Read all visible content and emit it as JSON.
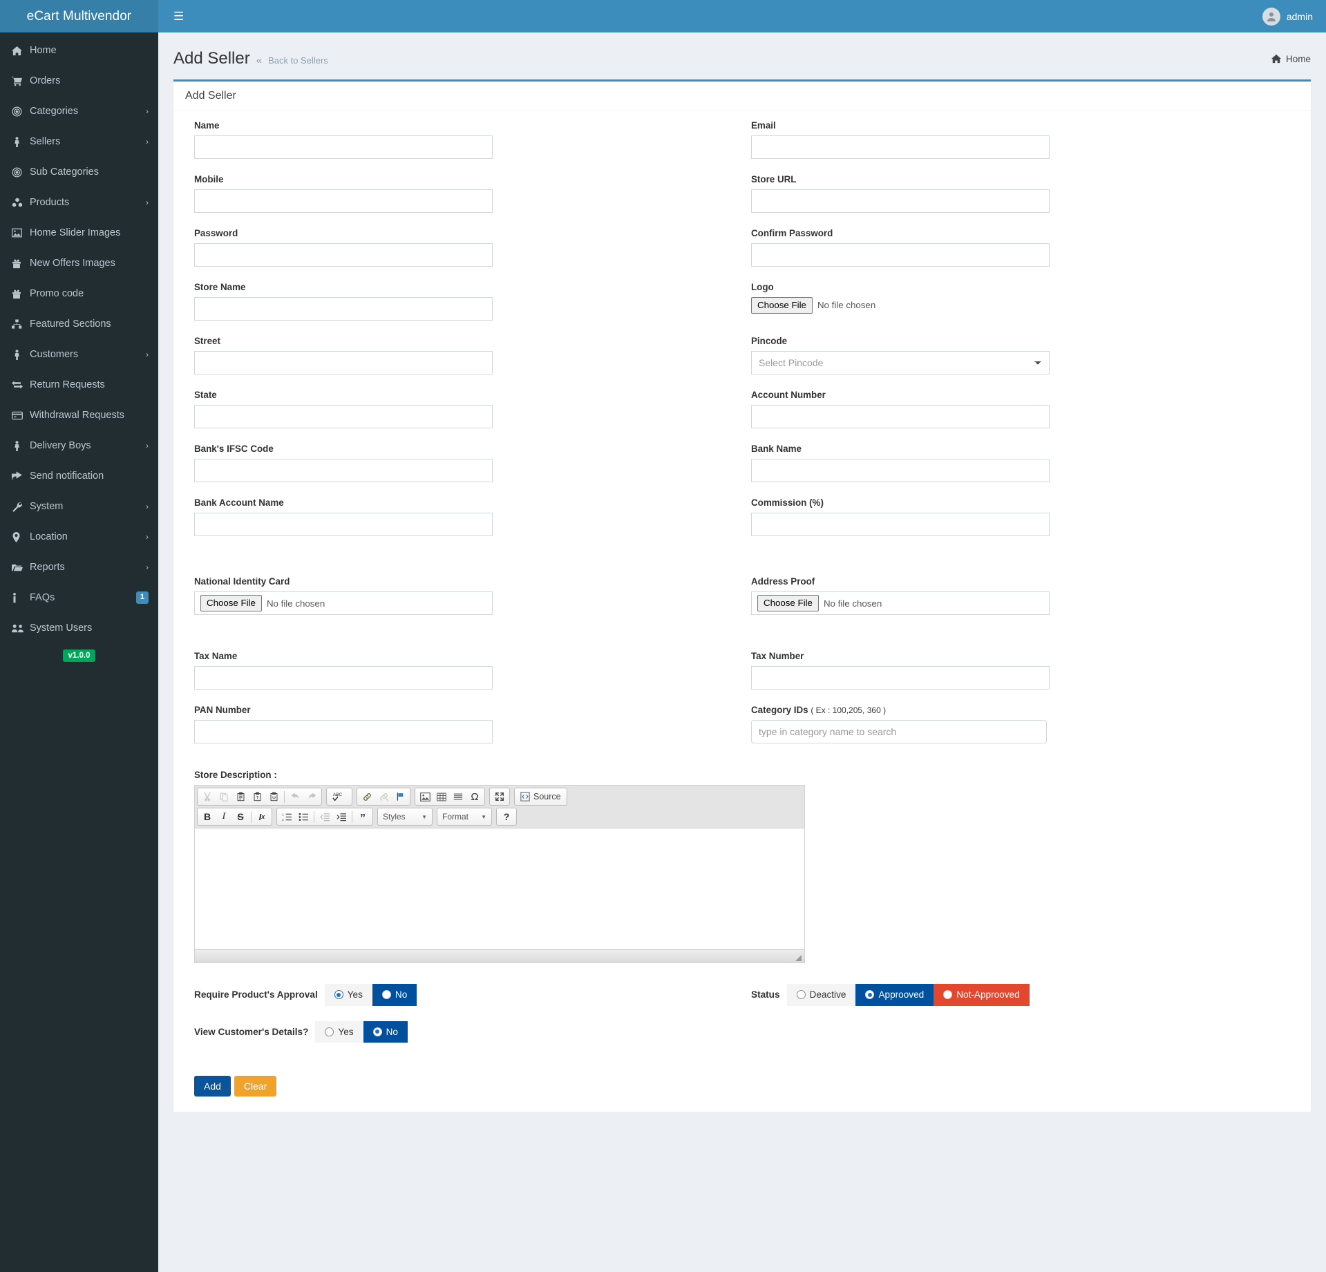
{
  "brand": {
    "title": "eCart Multivendor",
    "version": "v1.0.0"
  },
  "topbar": {
    "menu_toggle_icon": "hamburger-icon",
    "user_name": "admin"
  },
  "sidebar": {
    "items": [
      {
        "label": "Home",
        "icon": "home-icon",
        "arrow": ""
      },
      {
        "label": "Orders",
        "icon": "cart-icon",
        "arrow": ""
      },
      {
        "label": "Categories",
        "icon": "target-icon",
        "arrow": "›"
      },
      {
        "label": "Sellers",
        "icon": "person-icon",
        "arrow": "›"
      },
      {
        "label": "Sub Categories",
        "icon": "target-icon",
        "arrow": ""
      },
      {
        "label": "Products",
        "icon": "cubes-icon",
        "arrow": "›"
      },
      {
        "label": "Home Slider Images",
        "icon": "image-icon",
        "arrow": ""
      },
      {
        "label": "New Offers Images",
        "icon": "gift-icon",
        "arrow": ""
      },
      {
        "label": "Promo code",
        "icon": "gift-icon",
        "arrow": ""
      },
      {
        "label": "Featured Sections",
        "icon": "sitemap-icon",
        "arrow": ""
      },
      {
        "label": "Customers",
        "icon": "person-icon",
        "arrow": "›"
      },
      {
        "label": "Return Requests",
        "icon": "exchange-icon",
        "arrow": ""
      },
      {
        "label": "Withdrawal Requests",
        "icon": "credit-card-icon",
        "arrow": ""
      },
      {
        "label": "Delivery Boys",
        "icon": "person-icon",
        "arrow": "›"
      },
      {
        "label": "Send notification",
        "icon": "share-icon",
        "arrow": ""
      },
      {
        "label": "System",
        "icon": "wrench-icon",
        "arrow": "›"
      },
      {
        "label": "Location",
        "icon": "map-pin-icon",
        "arrow": "›"
      },
      {
        "label": "Reports",
        "icon": "folder-open-icon",
        "arrow": "›"
      },
      {
        "label": "FAQs",
        "icon": "info-icon",
        "arrow": "",
        "badge": "1"
      },
      {
        "label": "System Users",
        "icon": "users-icon",
        "arrow": ""
      }
    ]
  },
  "page": {
    "title": "Add Seller",
    "back_chevron": "«",
    "back_link": "Back to Sellers",
    "breadcrumb_home": "Home"
  },
  "box": {
    "title": "Add Seller"
  },
  "form": {
    "name": {
      "label": "Name",
      "value": ""
    },
    "email": {
      "label": "Email",
      "value": ""
    },
    "mobile": {
      "label": "Mobile",
      "value": ""
    },
    "store_url": {
      "label": "Store URL",
      "value": ""
    },
    "password": {
      "label": "Password",
      "value": ""
    },
    "confirm_password": {
      "label": "Confirm Password",
      "value": ""
    },
    "store_name": {
      "label": "Store Name",
      "value": ""
    },
    "logo": {
      "label": "Logo",
      "button": "Choose File",
      "status": "No file chosen"
    },
    "street": {
      "label": "Street",
      "value": ""
    },
    "pincode": {
      "label": "Pincode",
      "selected": "Select Pincode"
    },
    "state": {
      "label": "State",
      "value": ""
    },
    "account_number": {
      "label": "Account Number",
      "value": ""
    },
    "ifsc": {
      "label": "Bank's IFSC Code",
      "value": ""
    },
    "bank_name": {
      "label": "Bank Name",
      "value": ""
    },
    "bank_account_name": {
      "label": "Bank Account Name",
      "value": ""
    },
    "commission": {
      "label": "Commission (%)",
      "value": ""
    },
    "national_id": {
      "label": "National Identity Card",
      "button": "Choose File",
      "status": "No file chosen"
    },
    "address_proof": {
      "label": "Address Proof",
      "button": "Choose File",
      "status": "No file chosen"
    },
    "tax_name": {
      "label": "Tax Name",
      "value": ""
    },
    "tax_number": {
      "label": "Tax Number",
      "value": ""
    },
    "pan_number": {
      "label": "PAN Number",
      "value": ""
    },
    "category_ids": {
      "label": "Category IDs",
      "hint": "( Ex : 100,205, 360 )",
      "placeholder": "type in category name to search",
      "value": ""
    },
    "store_description": {
      "label": "Store Description :",
      "content": ""
    }
  },
  "editor": {
    "toolbar_row1": [
      {
        "name": "cut-icon",
        "glyph": "✂",
        "disabled": true
      },
      {
        "name": "copy-icon",
        "glyph": "❐",
        "disabled": true
      },
      {
        "name": "paste-icon",
        "glyph": "ὌB",
        "disabled": false
      },
      {
        "name": "paste-as-text-icon",
        "glyph": "T",
        "disabled": false
      },
      {
        "name": "paste-from-word-icon",
        "glyph": "W",
        "disabled": false
      },
      {
        "name": "undo-icon",
        "glyph": "↶",
        "disabled": true
      },
      {
        "name": "redo-icon",
        "glyph": "↷",
        "disabled": true
      },
      {
        "name": "spellcheck-icon",
        "glyph": "ABC",
        "disabled": false
      },
      {
        "name": "link-icon",
        "glyph": "ὑ7",
        "disabled": false
      },
      {
        "name": "unlink-icon",
        "glyph": "ὑ7",
        "disabled": true
      },
      {
        "name": "anchor-flag-icon",
        "glyph": "⚑",
        "disabled": false
      },
      {
        "name": "image-icon",
        "glyph": "ὛC",
        "disabled": false
      },
      {
        "name": "table-icon",
        "glyph": "▦",
        "disabled": false
      },
      {
        "name": "horizontal-rule-icon",
        "glyph": "☰",
        "disabled": false
      },
      {
        "name": "special-char-icon",
        "glyph": "Ω",
        "disabled": false
      },
      {
        "name": "maximize-icon",
        "glyph": "⤡",
        "disabled": false
      }
    ],
    "source_button": "Source",
    "toolbar_row2": [
      {
        "name": "bold-icon",
        "glyph": "B"
      },
      {
        "name": "italic-icon",
        "glyph": "I"
      },
      {
        "name": "strikethrough-icon",
        "glyph": "S"
      },
      {
        "name": "remove-format-icon",
        "glyph": "Ix"
      },
      {
        "name": "numbered-list-icon",
        "glyph": "1≡"
      },
      {
        "name": "bulleted-list-icon",
        "glyph": "•≡"
      },
      {
        "name": "outdent-icon",
        "glyph": "≡",
        "disabled": true
      },
      {
        "name": "indent-icon",
        "glyph": "≡"
      },
      {
        "name": "blockquote-icon",
        "glyph": "”"
      }
    ],
    "styles_combo": "Styles",
    "format_combo": "Format",
    "help_button": "?"
  },
  "toggles": {
    "require_approval": {
      "label": "Require Product's Approval",
      "options": [
        {
          "label": "Yes",
          "selected": true,
          "style": "light"
        },
        {
          "label": "No",
          "selected": false,
          "style": "blue"
        }
      ]
    },
    "status": {
      "label": "Status",
      "options": [
        {
          "label": "Deactive",
          "selected": false,
          "style": "light"
        },
        {
          "label": "Approoved",
          "selected": true,
          "style": "blue"
        },
        {
          "label": "Not-Approoved",
          "selected": false,
          "style": "red"
        }
      ]
    },
    "view_customer_details": {
      "label": "View Customer's Details?",
      "options": [
        {
          "label": "Yes",
          "selected": false,
          "style": "light"
        },
        {
          "label": "No",
          "selected": true,
          "style": "blue"
        }
      ]
    }
  },
  "actions": {
    "add": "Add",
    "clear": "Clear"
  },
  "colors": {
    "sidebar_bg": "#222d32",
    "brand_bg": "#367fa9",
    "topbar_bg": "#3c8dbc",
    "accent": "#3c8dbc",
    "primary_btn": "#0a549b",
    "warning_btn": "#f0a32a",
    "danger": "#e3482f",
    "success_badge": "#00a65a"
  }
}
